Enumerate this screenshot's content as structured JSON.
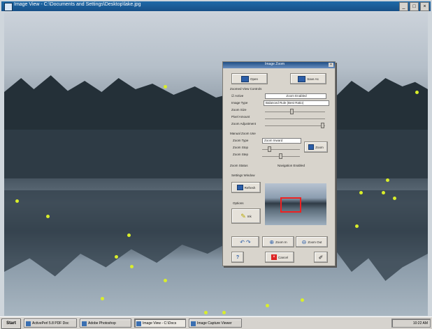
{
  "window": {
    "title": "Image View - C:\\Documents and Settings\\Desktop\\lake.jpg",
    "controls": [
      "_",
      "□",
      "×"
    ]
  },
  "dialog": {
    "title": "Image Zoom",
    "open_label": "Open",
    "save_label": "Save As",
    "section_zoom": "Zoomed View Controls",
    "enable_label": "Active",
    "enable_value": "Zoom Enabled",
    "image_size_label": "Image Type",
    "image_size_value": "Balanced Rule  (Best Ratio)",
    "slider1_label": "Zoom Size",
    "slider2_label": "Pixel Amount",
    "slider3_label": "Zoom Adjustment",
    "section_manual": "Manual Zoom Use",
    "zoom_type_label": "Zoom Type",
    "zoom_type_value": "Zoom Inward",
    "zoom_btn_label": "Zoom",
    "slider4_label": "Zoom Stop",
    "slider5_label": "Zoom Step",
    "text_label": "Zoom Status",
    "text_value": "Navigation Enabled",
    "section_preview": "Settings Window",
    "reset_label": "Refresh",
    "section_color": "Options",
    "pencil_label": "Ink",
    "zoomin_label": "Zoom In",
    "zoomout_label": "Zoom Out",
    "cancel_label": "Cancel",
    "help_icon": "?"
  },
  "taskbar": {
    "start": "Start",
    "tasks": [
      "ActivePerl 5.8  PDF Doc",
      "Adobe Photoshop",
      "Image View - C:\\Docs",
      "Image Capture Viewer"
    ],
    "clock": "10:22 AM"
  },
  "colors": {
    "accent": "#1f6aa8",
    "firefly": "#d9ee2a",
    "dialog_bg": "#d8d4cc"
  }
}
